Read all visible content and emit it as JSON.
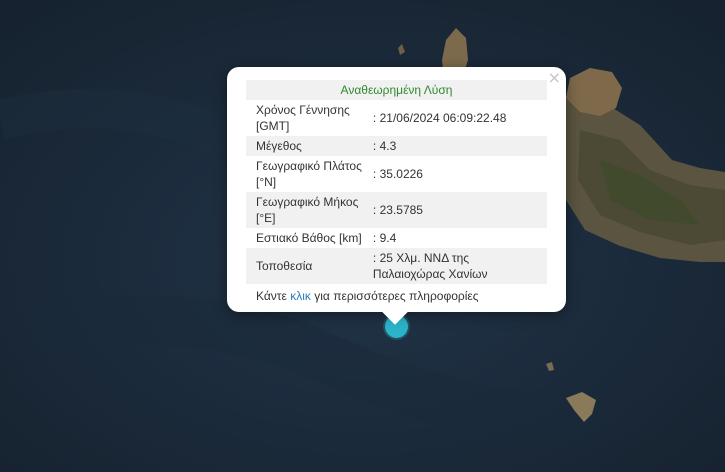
{
  "popup": {
    "title": "Αναθεωρημένη Λύση",
    "close_symbol": "×",
    "rows": [
      {
        "label": "Χρόνος Γέννησης [GMT]",
        "value": ": 21/06/2024 06:09:22.48"
      },
      {
        "label": "Μέγεθος",
        "value": ": 4.3"
      },
      {
        "label": "Γεωγραφικό Πλάτος [°N]",
        "value": ": 35.0226"
      },
      {
        "label": "Γεωγραφικό Μήκος [°E]",
        "value": ": 23.5785"
      },
      {
        "label": "Εστιακό Βάθος [km]",
        "value": ": 9.4"
      },
      {
        "label": "Τοποθεσία",
        "value": ": 25 Χλμ. ΝΝΔ της Παλαιοχώρας Χανίων"
      }
    ],
    "more_prefix": "Κάντε",
    "more_link": "κλικ",
    "more_suffix": "για περισσότερες πληροφορίες"
  },
  "marker": {
    "color": "#2bb3c9",
    "icon": "earthquake-marker"
  }
}
